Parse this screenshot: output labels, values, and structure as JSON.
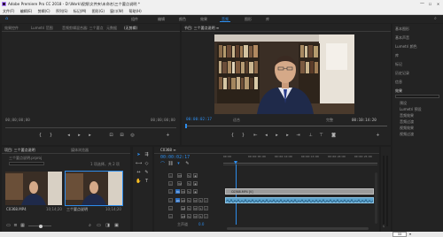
{
  "titlebar": {
    "title": "Adobe Premiere Pro CC 2018 - D:\\Work\\视频\\文件夹\\未命名\\三个要点说明 *",
    "minimize": "—",
    "maximize": "☐",
    "close": "✕"
  },
  "menubar": {
    "items": [
      "文件(F)",
      "编辑(E)",
      "剪辑(C)",
      "序列(S)",
      "标记(M)",
      "图形(G)",
      "窗口(W)",
      "帮助(H)"
    ]
  },
  "workspaces": {
    "items": [
      "组件",
      "编辑",
      "颜色",
      "效果",
      "音频",
      "图形",
      "库"
    ],
    "active_index": 4
  },
  "source_panel": {
    "tabs": [
      "效果控件",
      "Lumetri 范围",
      "音频剪辑混合器: 三个要点",
      "元数据",
      "(无剪辑)"
    ],
    "tc_left": "00;00;00;00",
    "tc_right": "00;00;00;00"
  },
  "program_panel": {
    "title": "节目: 三个要点说明 ≡",
    "tc_current": "00:00:02:17",
    "fit": "适合",
    "quality": "完整",
    "tc_duration": "00:10:14:20",
    "ruler": [
      "00:00",
      "00:02:00:00",
      "00:04:00:00",
      "00:06:00:00"
    ]
  },
  "right_panel": {
    "items": [
      "基本图形",
      "基本声音",
      "Lumetri 颜色",
      "库",
      "标记",
      "历史记录",
      "信息"
    ],
    "effects_title": "效果",
    "effects_items": [
      "预设",
      "Lumetri 预设",
      "音频效果",
      "音频过渡",
      "视频效果",
      "视频过渡"
    ]
  },
  "project_panel": {
    "tabs": [
      "项目: 三个要点说明",
      "媒体浏览器"
    ],
    "project_file": "三个要点说明.prproj",
    "item_count": "1 项选择，共 2 项",
    "clips": [
      {
        "name": "C0368.MP4",
        "duration": "10;14;20"
      },
      {
        "name": "三个要点说明",
        "duration": "10;14;20"
      }
    ]
  },
  "timeline": {
    "tab": "C0368 ≡",
    "tc_current": "00:00:02:17",
    "ruler": [
      "00:00",
      "00:00:05:00",
      "00:00:10:00",
      "00:00:15:00",
      "00:00:20:00",
      "00:00:25:00"
    ],
    "video_tracks": [
      "V3",
      "V2",
      "V1"
    ],
    "audio_tracks": [
      "A1",
      "A2",
      "A3"
    ],
    "master": "主声道",
    "master_value": "0.0",
    "clip_label": "C0368.MP4 [V]",
    "zoom_readout": "33"
  },
  "colors": {
    "accent": "#2d8ceb",
    "panel": "#232323",
    "bg": "#1e1e1e",
    "video_clip": "#9b9b9b",
    "audio_clip": "#5ba2cc"
  }
}
